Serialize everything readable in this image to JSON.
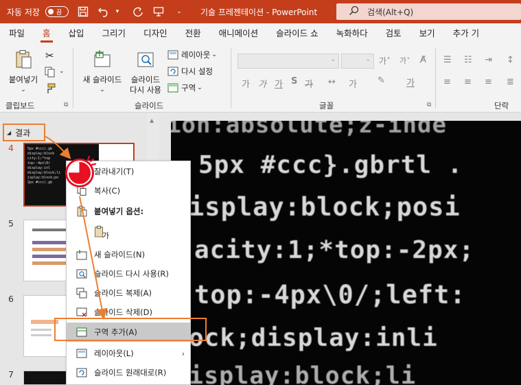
{
  "titlebar": {
    "autosave_label": "자동 저장",
    "toggle_state": "끔",
    "doc_title": "기술 프레젠테이션  -  PowerPoint",
    "search_placeholder": "검색(Alt+Q)",
    "icons": [
      "save-icon",
      "undo-icon",
      "redo-icon",
      "present-icon",
      "customize-icon"
    ]
  },
  "menu": {
    "tabs": [
      "파일",
      "홈",
      "삽입",
      "그리기",
      "디자인",
      "전환",
      "애니메이션",
      "슬라이드 쇼",
      "녹화하다",
      "검토",
      "보기",
      "추가 기"
    ],
    "active_index": 1
  },
  "ribbon": {
    "clipboard": {
      "paste_label": "붙여넣기",
      "group_label": "클립보드"
    },
    "slides": {
      "new_slide_label": "새 슬라이드",
      "reuse_line1": "슬라이드",
      "reuse_line2": "다시 사용",
      "layout_label": "레이아웃",
      "reset_label": "다시 설정",
      "section_label": "구역",
      "group_label": "슬라이드"
    },
    "font": {
      "group_label": "글꼴",
      "glyphs": [
        "가",
        "가",
        "가",
        "S",
        "가",
        "가",
        "가"
      ]
    },
    "paragraph": {
      "group_label": "단락"
    }
  },
  "left_panel": {
    "section_header": "결과",
    "slide_numbers": [
      "4",
      "5",
      "6",
      "7"
    ]
  },
  "main_slide": {
    "code_lines": [
      "ion:absolute;z-inde",
      "5px #ccc}.gbrtl .",
      "isplay:block;posi",
      "acity:1;*top:-2px;",
      "top:-4px\\0/;left:",
      "ock;display:inli",
      "isplay:block;li"
    ]
  },
  "context_menu": {
    "items": [
      {
        "label": "잘라내기(T)",
        "icon": "cut-icon"
      },
      {
        "label": "복사(C)",
        "icon": "copy-icon"
      },
      {
        "label": "붙여넣기 옵션:",
        "icon": "paste-icon"
      },
      {
        "label": "",
        "icon": "paste-keep-text-icon"
      },
      {
        "label": "새 슬라이드(N)",
        "icon": "new-slide-icon"
      },
      {
        "label": "슬라이드 다시 사용(R)",
        "icon": "reuse-slides-icon"
      },
      {
        "label": "슬라이드 복제(A)",
        "icon": "duplicate-slide-icon"
      },
      {
        "label": "슬라이드 삭제(D)",
        "icon": "delete-slide-icon"
      },
      {
        "label": "구역 추가(A)",
        "icon": "add-section-icon"
      },
      {
        "label": "레이아웃(L)",
        "icon": "layout-icon"
      },
      {
        "label": "슬라이드 원래대로(R)",
        "icon": "reset-slide-icon"
      }
    ],
    "paste_option_glyph": "가",
    "highlighted_index": 8
  },
  "colors": {
    "accent": "#c43e1c",
    "callout": "#ed7d31",
    "click_indicator": "#e81123"
  }
}
